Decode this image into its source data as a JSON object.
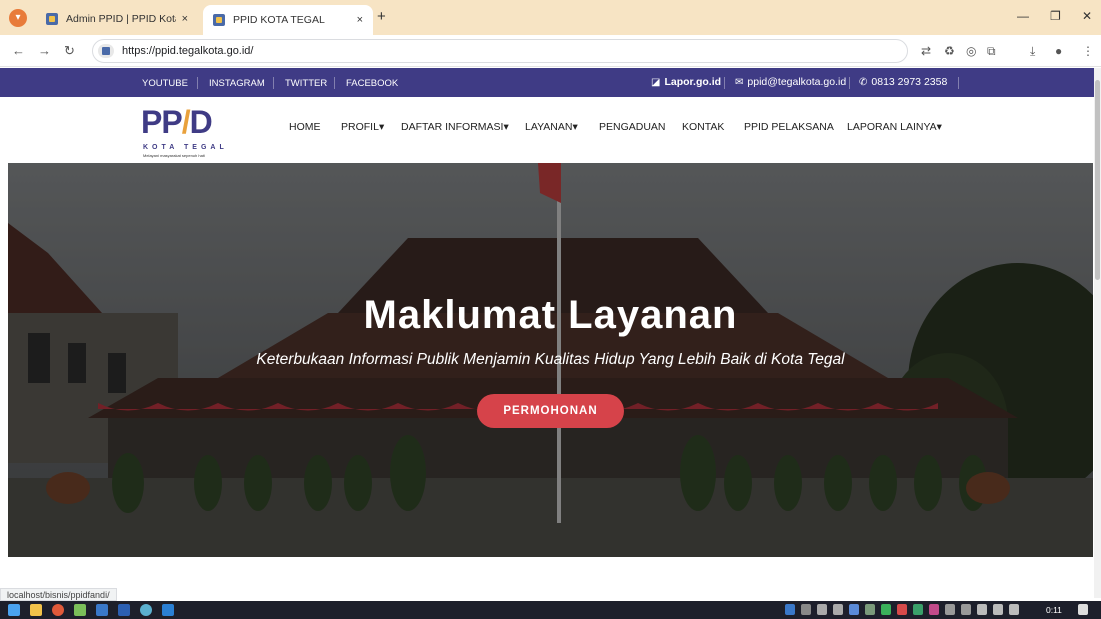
{
  "browser": {
    "tabs": [
      {
        "label": "Admin PPID | PPID Kota Tegal"
      },
      {
        "label": "PPID KOTA TEGAL"
      }
    ],
    "close_glyph": "×",
    "new_tab_glyph": "+",
    "url": "https://ppid.tegalkota.go.id/",
    "status_url": "localhost/bisnis/ppidfandi/"
  },
  "topbar": {
    "social": [
      "YOUTUBE",
      "INSTAGRAM",
      "TWITTER",
      "FACEBOOK"
    ],
    "lapor": "Lapor.go.id",
    "email": "ppid@tegalkota.go.id",
    "phone": "0813 2973 2358"
  },
  "logo": {
    "text": "PPID",
    "subtitle": "KOTA TEGAL",
    "tagline": "Melayani masyarakat sepenuh hati"
  },
  "nav": {
    "items": [
      "HOME",
      "PROFIL",
      "DAFTAR INFORMASI",
      "LAYANAN",
      "PENGADUAN",
      "KONTAK",
      "PPID PELAKSANA",
      "LAPORAN LAINYA"
    ],
    "dropdown_caret": "▾"
  },
  "hero": {
    "title": "Maklumat Layanan",
    "subtitle": "Keterbukaan Informasi Publik Menjamin Kualitas Hidup Yang Lebih Baik di Kota Tegal",
    "button": "PERMOHONAN"
  },
  "taskbar": {
    "time": "0:11"
  },
  "colors": {
    "brand_purple": "#3f3b85",
    "accent_red": "#d6434a",
    "tabbar": "#f7e4c4"
  }
}
